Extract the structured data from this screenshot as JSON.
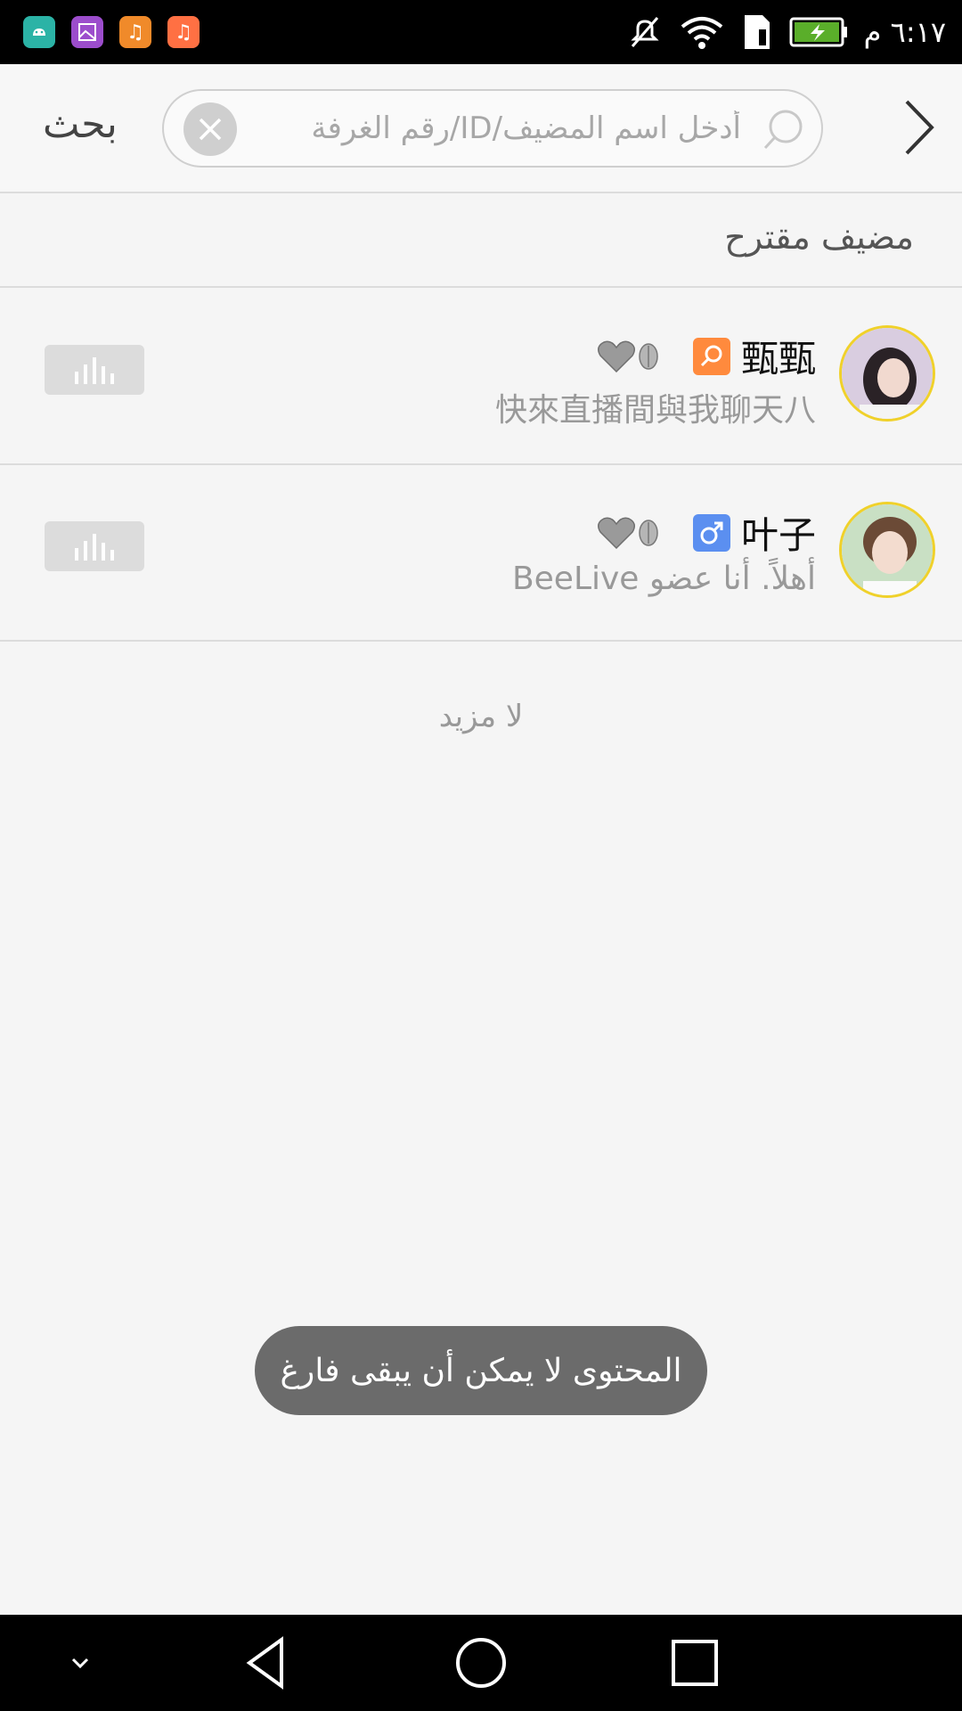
{
  "status_bar": {
    "time": "٦:١٧ م",
    "app_icons": [
      {
        "icon": "android-icon",
        "color": "#2bb3a6"
      },
      {
        "icon": "gallery-icon",
        "color": "#9c4dcc"
      },
      {
        "icon": "music-icon",
        "color": "#f08a2a"
      },
      {
        "icon": "music-icon",
        "color": "#ff7043"
      }
    ]
  },
  "header": {
    "back_icon": "chevron-right-icon",
    "search_placeholder": "أدخل اسم المضيف/ID/رقم الغرفة",
    "search_value": "",
    "search_label": "بحث"
  },
  "section": {
    "title": "مضيف مقترح"
  },
  "hosts": [
    {
      "name": "甄甄",
      "gender_icon": "female-icon",
      "gender_color": "#ff8a3d",
      "bio": "快來直播間與我聊天八",
      "avatar_color": "#d8c8d8"
    },
    {
      "name": "叶子",
      "gender_icon": "male-icon",
      "gender_color": "#5b8ff0",
      "bio": "أهلاً. أنا عضو BeeLive",
      "avatar_color": "#cfe6cf"
    }
  ],
  "footer": {
    "no_more": "لا مزيد"
  },
  "toast": {
    "message": "المحتوى لا يمكن أن يبقى فارغ"
  },
  "colors": {
    "accent_border": "#f0d12a",
    "toast_bg": "#6b6b6b"
  }
}
